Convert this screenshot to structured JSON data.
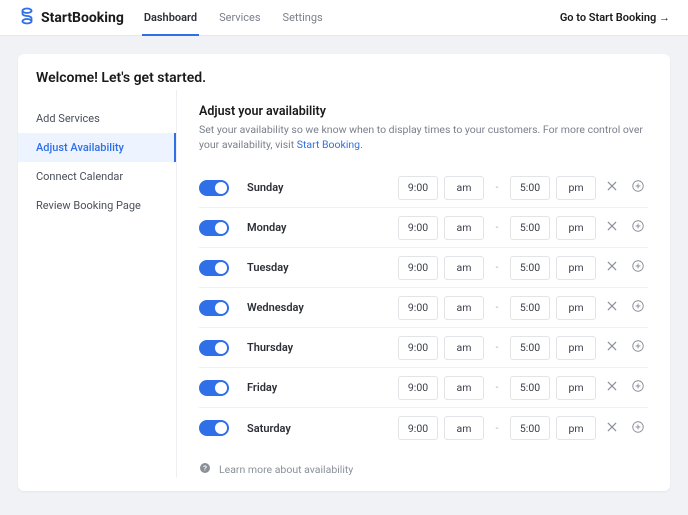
{
  "brand": "StartBooking",
  "nav": {
    "dashboard": "Dashboard",
    "services": "Services",
    "settings": "Settings"
  },
  "goto": "Go to Start Booking →",
  "welcome": "Welcome! Let's get started.",
  "sidebar": {
    "add_services": "Add Services",
    "adjust_availability": "Adjust Availability",
    "connect_calendar": "Connect Calendar",
    "review_booking_page": "Review Booking Page"
  },
  "main": {
    "title": "Adjust your availability",
    "desc_prefix": "Set your availability so we know when to display times to your customers. For more control over your availability, visit ",
    "desc_link": "Start Booking",
    "desc_suffix": "."
  },
  "time": {
    "start_hour": "9:00",
    "start_ampm": "am",
    "dash": "-",
    "end_hour": "5:00",
    "end_ampm": "pm"
  },
  "days": {
    "sunday": "Sunday",
    "monday": "Monday",
    "tuesday": "Tuesday",
    "wednesday": "Wednesday",
    "thursday": "Thursday",
    "friday": "Friday",
    "saturday": "Saturday"
  },
  "learn": "Learn more about availability"
}
